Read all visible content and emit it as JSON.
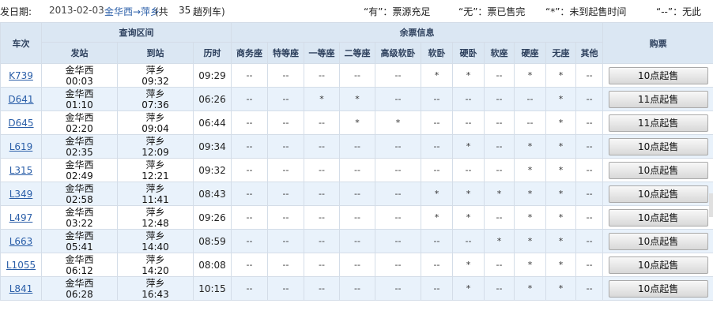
{
  "top": {
    "date_label": "发日期:",
    "date_value": "2013-02-03",
    "route": "金华西→萍乡",
    "count_prefix": "(共",
    "count": "35",
    "count_suffix": "趟列车)",
    "legend": [
      "“有”：票源充足",
      "“无”：票已售完",
      "“*”：未到起售时间",
      "“--”：无此"
    ]
  },
  "headers": {
    "train": "车次",
    "query_section": "查询区间",
    "depart": "发站",
    "arrive": "到站",
    "duration": "历时",
    "remaining": "余票信息",
    "seats": [
      "商务座",
      "特等座",
      "一等座",
      "二等座",
      "高级软卧",
      "软卧",
      "硬卧",
      "软座",
      "硬座",
      "无座",
      "其他"
    ],
    "buy": "购票"
  },
  "trains": [
    {
      "no": "K739",
      "from": "金华西",
      "dep": "00:03",
      "to": "萍乡",
      "arr": "09:32",
      "dur": "09:29",
      "seats": [
        "--",
        "--",
        "--",
        "--",
        "--",
        "*",
        "*",
        "--",
        "*",
        "*",
        "--"
      ],
      "buy": "10点起售"
    },
    {
      "no": "D641",
      "from": "金华西",
      "dep": "01:10",
      "to": "萍乡",
      "arr": "07:36",
      "dur": "06:26",
      "seats": [
        "--",
        "--",
        "*",
        "*",
        "--",
        "--",
        "--",
        "--",
        "--",
        "*",
        "--"
      ],
      "buy": "11点起售"
    },
    {
      "no": "D645",
      "from": "金华西",
      "dep": "02:20",
      "to": "萍乡",
      "arr": "09:04",
      "dur": "06:44",
      "seats": [
        "--",
        "--",
        "--",
        "*",
        "*",
        "--",
        "--",
        "--",
        "--",
        "*",
        "--"
      ],
      "buy": "11点起售"
    },
    {
      "no": "L619",
      "from": "金华西",
      "dep": "02:35",
      "to": "萍乡",
      "arr": "12:09",
      "dur": "09:34",
      "seats": [
        "--",
        "--",
        "--",
        "--",
        "--",
        "--",
        "*",
        "--",
        "*",
        "*",
        "--"
      ],
      "buy": "10点起售"
    },
    {
      "no": "L315",
      "from": "金华西",
      "dep": "02:49",
      "to": "萍乡",
      "arr": "12:21",
      "dur": "09:32",
      "seats": [
        "--",
        "--",
        "--",
        "--",
        "--",
        "--",
        "--",
        "--",
        "*",
        "*",
        "--"
      ],
      "buy": "10点起售"
    },
    {
      "no": "L349",
      "from": "金华西",
      "dep": "02:58",
      "to": "萍乡",
      "arr": "11:41",
      "dur": "08:43",
      "seats": [
        "--",
        "--",
        "--",
        "--",
        "--",
        "*",
        "*",
        "*",
        "*",
        "*",
        "--"
      ],
      "buy": "10点起售"
    },
    {
      "no": "L497",
      "from": "金华西",
      "dep": "03:22",
      "to": "萍乡",
      "arr": "12:48",
      "dur": "09:26",
      "seats": [
        "--",
        "--",
        "--",
        "--",
        "--",
        "*",
        "*",
        "--",
        "*",
        "*",
        "--"
      ],
      "buy": "10点起售"
    },
    {
      "no": "L663",
      "from": "金华西",
      "dep": "05:41",
      "to": "萍乡",
      "arr": "14:40",
      "dur": "08:59",
      "seats": [
        "--",
        "--",
        "--",
        "--",
        "--",
        "--",
        "--",
        "*",
        "*",
        "*",
        "--"
      ],
      "buy": "10点起售"
    },
    {
      "no": "L1055",
      "from": "金华西",
      "dep": "06:12",
      "to": "萍乡",
      "arr": "14:20",
      "dur": "08:08",
      "seats": [
        "--",
        "--",
        "--",
        "--",
        "--",
        "--",
        "*",
        "--",
        "*",
        "*",
        "--"
      ],
      "buy": "10点起售"
    },
    {
      "no": "L841",
      "from": "金华西",
      "dep": "06:28",
      "to": "萍乡",
      "arr": "16:43",
      "dur": "10:15",
      "seats": [
        "--",
        "--",
        "--",
        "--",
        "--",
        "--",
        "*",
        "--",
        "*",
        "*",
        "--"
      ],
      "buy": "10点起售"
    }
  ]
}
